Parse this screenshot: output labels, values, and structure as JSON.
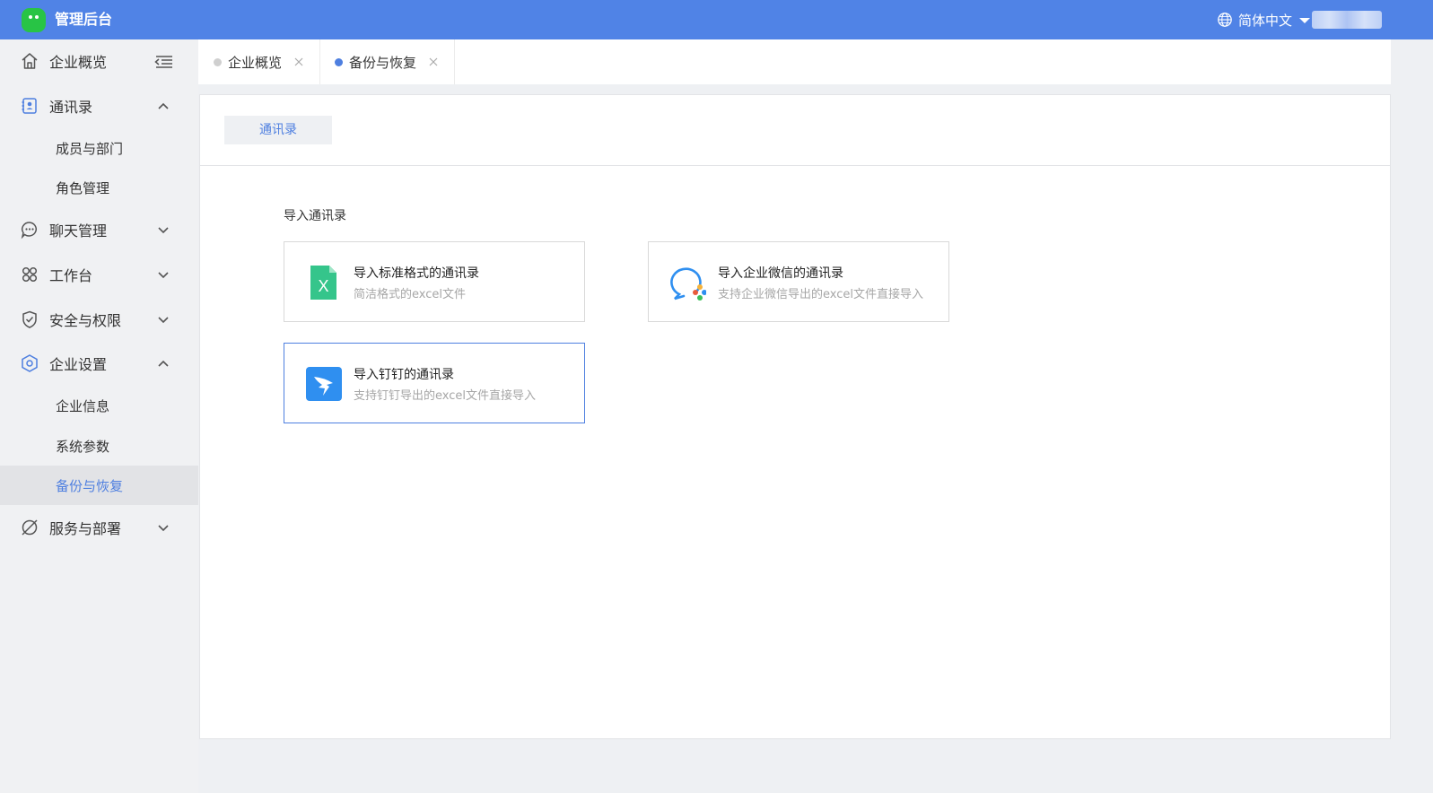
{
  "header": {
    "app_title": "管理后台",
    "language": "简体中文",
    "brand_color": "#5083e6"
  },
  "sidebar": {
    "items": [
      {
        "label": "企业概览",
        "icon": "home-icon"
      },
      {
        "label": "通讯录",
        "icon": "contacts-icon",
        "expanded": true
      },
      {
        "label": "聊天管理",
        "icon": "chat-icon",
        "expanded": false
      },
      {
        "label": "工作台",
        "icon": "workbench-icon",
        "expanded": false
      },
      {
        "label": "安全与权限",
        "icon": "shield-icon",
        "expanded": false
      },
      {
        "label": "企业设置",
        "icon": "settings-icon",
        "expanded": true
      },
      {
        "label": "服务与部署",
        "icon": "service-icon",
        "expanded": false
      }
    ],
    "contacts_sub": [
      "成员与部门",
      "角色管理"
    ],
    "settings_sub": [
      "企业信息",
      "系统参数",
      "备份与恢复"
    ],
    "active_sub": "备份与恢复"
  },
  "tabs": [
    {
      "label": "企业概览",
      "active": false
    },
    {
      "label": "备份与恢复",
      "active": true
    }
  ],
  "main": {
    "panel_tab": "通讯录",
    "section_title": "导入通讯录",
    "cards": [
      {
        "title": "导入标准格式的通讯录",
        "desc": "简洁格式的excel文件",
        "icon": "excel-icon"
      },
      {
        "title": "导入企业微信的通讯录",
        "desc": "支持企业微信导出的excel文件直接导入",
        "icon": "wecom-icon"
      },
      {
        "title": "导入钉钉的通讯录",
        "desc": "支持钉钉导出的excel文件直接导入",
        "icon": "dingtalk-icon"
      }
    ]
  },
  "colors": {
    "accent": "#4e7fe0",
    "inactive_dot": "#cfcfcf"
  }
}
